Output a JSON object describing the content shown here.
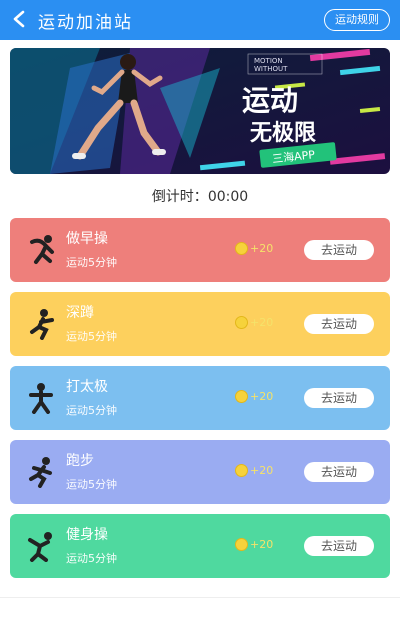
{
  "header": {
    "title": "运动加油站",
    "rules_label": "运动规则"
  },
  "banner": {
    "tag_line1": "MOTION",
    "tag_line2": "WITHOUT",
    "slogan_line1": "运动",
    "slogan_line2": "无极限",
    "brand": "三海APP"
  },
  "countdown": {
    "label": "倒计时：",
    "value": "00:00"
  },
  "activities": [
    {
      "name": "做早操",
      "duration": "运动5分钟",
      "points": "+20",
      "action": "去运动",
      "color": "#ee7f7b",
      "icon": "morning-exercise-icon"
    },
    {
      "name": "深蹲",
      "duration": "运动5分钟",
      "points": "+20",
      "action": "去运动",
      "color": "#fdd05d",
      "icon": "squat-icon"
    },
    {
      "name": "打太极",
      "duration": "运动5分钟",
      "points": "+20",
      "action": "去运动",
      "color": "#7cbff0",
      "icon": "tai-chi-icon"
    },
    {
      "name": "跑步",
      "duration": "运动5分钟",
      "points": "+20",
      "action": "去运动",
      "color": "#9aacf2",
      "icon": "running-icon"
    },
    {
      "name": "健身操",
      "duration": "运动5分钟",
      "points": "+20",
      "action": "去运动",
      "color": "#4fd99f",
      "icon": "aerobics-icon"
    }
  ]
}
